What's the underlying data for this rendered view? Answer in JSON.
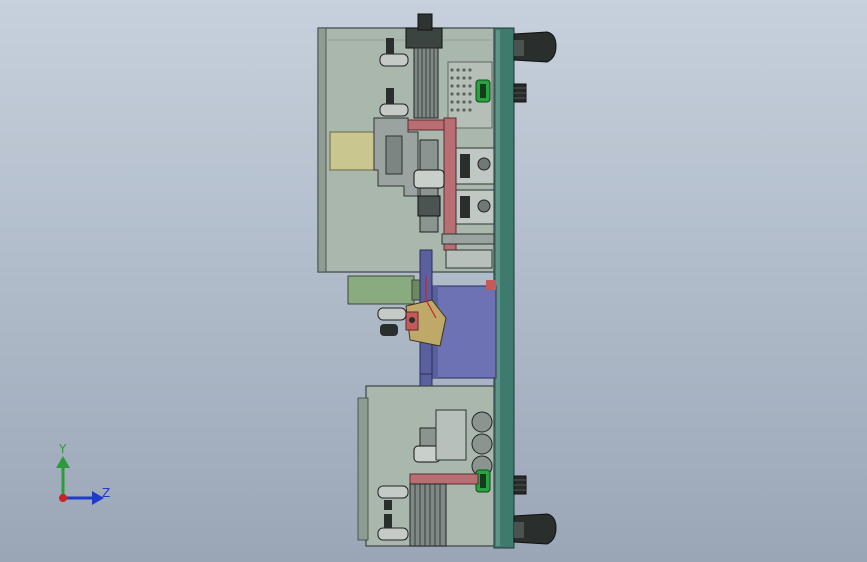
{
  "viewport": {
    "background_top": "#c7d0dc",
    "background_bottom": "#9aa6b6"
  },
  "triad": {
    "y_label": "Y",
    "z_label": "Z",
    "y_color": "#2e9b3a",
    "z_color": "#1e3cc8",
    "origin_color": "#cc2222"
  },
  "colors": {
    "base_plate": "#3f7a6e",
    "housing": "#a9b7ad",
    "housing_edge": "#4a524c",
    "clamp_block": "#9aa3a0",
    "pad": "#c9c68f",
    "guide_rail": "#b86e72",
    "slider_block": "#6d72b5",
    "green_block": "#8aab7f",
    "bushing": "#2a2f2d",
    "dark_part": "#3c4441",
    "green_ring": "#27a33f",
    "red_wire": "#d0202a"
  },
  "assembly": {
    "view": "side elevation",
    "modules": [
      "upper-actuator-module",
      "center-slide-module",
      "lower-actuator-module"
    ]
  }
}
